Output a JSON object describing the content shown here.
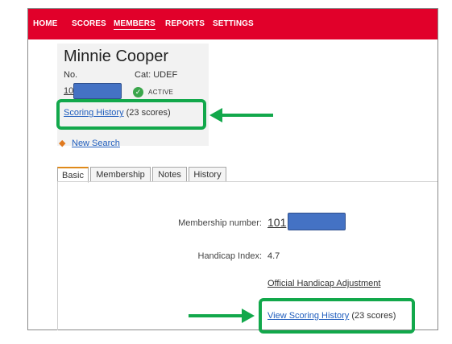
{
  "nav": {
    "items": [
      "HOME",
      "SCORES",
      "MEMBERS",
      "REPORTS",
      "SETTINGS"
    ],
    "active": "MEMBERS"
  },
  "member": {
    "name": "Minnie Cooper",
    "no_label": "No.",
    "category": "Cat: UDEF",
    "number_prefix": "10",
    "status": "ACTIVE"
  },
  "scoring_history": {
    "link_label": "Scoring History",
    "count_text": "(23 scores)"
  },
  "new_search": "New Search",
  "tabs": [
    {
      "label": "Basic"
    },
    {
      "label": "Membership"
    },
    {
      "label": "Notes"
    },
    {
      "label": "History"
    }
  ],
  "basic": {
    "membership_number_label": "Membership number:",
    "membership_number_prefix": "101",
    "handicap_label": "Handicap Index:",
    "handicap_value": "4.7",
    "official_adjustment_link": "Official Handicap Adjustment",
    "view_scoring_history_link": "View Scoring History",
    "view_scoring_history_count": "(23 scores)"
  },
  "colors": {
    "nav_background": "#e1002a",
    "highlight_green": "#12a84b",
    "redaction_blue": "#4472c4",
    "link_blue": "#1f5dbd"
  },
  "icons": [
    "check-circle-icon",
    "back-arrow-icon"
  ]
}
